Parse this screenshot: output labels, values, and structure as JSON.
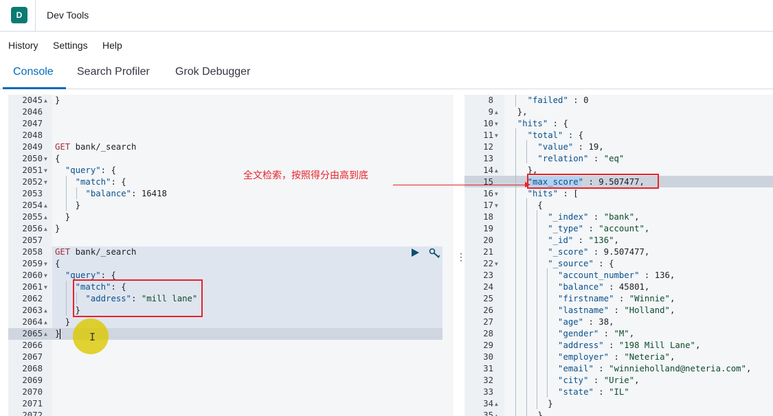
{
  "header": {
    "app_initial": "D",
    "title": "Dev Tools"
  },
  "menu": {
    "history": "History",
    "settings": "Settings",
    "help": "Help"
  },
  "tabs": {
    "console": "Console",
    "search_profiler": "Search Profiler",
    "grok_debugger": "Grok Debugger"
  },
  "annotation": {
    "text": "全文检索，按照得分由高到底"
  },
  "left_editor": {
    "lines": [
      {
        "n": "2045",
        "fold": "▲",
        "t": "}"
      },
      {
        "n": "2046",
        "fold": "",
        "t": ""
      },
      {
        "n": "2047",
        "fold": "",
        "t": ""
      },
      {
        "n": "2048",
        "fold": "",
        "t": ""
      },
      {
        "n": "2049",
        "fold": "",
        "t": "GET bank/_search"
      },
      {
        "n": "2050",
        "fold": "▼",
        "t": "{"
      },
      {
        "n": "2051",
        "fold": "▼",
        "t": "  \"query\": {"
      },
      {
        "n": "2052",
        "fold": "▼",
        "t": "    \"match\": {"
      },
      {
        "n": "2053",
        "fold": "",
        "t": "      \"balance\": 16418"
      },
      {
        "n": "2054",
        "fold": "▲",
        "t": "    }"
      },
      {
        "n": "2055",
        "fold": "▲",
        "t": "  }"
      },
      {
        "n": "2056",
        "fold": "▲",
        "t": "}"
      },
      {
        "n": "2057",
        "fold": "",
        "t": ""
      },
      {
        "n": "2058",
        "fold": "",
        "t": "GET bank/_search"
      },
      {
        "n": "2059",
        "fold": "▼",
        "t": "{"
      },
      {
        "n": "2060",
        "fold": "▼",
        "t": "  \"query\": {"
      },
      {
        "n": "2061",
        "fold": "▼",
        "t": "    \"match\": {"
      },
      {
        "n": "2062",
        "fold": "",
        "t": "      \"address\": \"mill lane\""
      },
      {
        "n": "2063",
        "fold": "▲",
        "t": "    }"
      },
      {
        "n": "2064",
        "fold": "▲",
        "t": "  }"
      },
      {
        "n": "2065",
        "fold": "▲",
        "t": "}"
      },
      {
        "n": "2066",
        "fold": "",
        "t": ""
      },
      {
        "n": "2067",
        "fold": "",
        "t": ""
      },
      {
        "n": "2068",
        "fold": "",
        "t": ""
      },
      {
        "n": "2069",
        "fold": "",
        "t": ""
      },
      {
        "n": "2070",
        "fold": "",
        "t": ""
      },
      {
        "n": "2071",
        "fold": "",
        "t": ""
      },
      {
        "n": "2072",
        "fold": "",
        "t": ""
      }
    ]
  },
  "right_editor": {
    "lines": [
      {
        "n": "8",
        "fold": "",
        "t": "    \"failed\" : 0"
      },
      {
        "n": "9",
        "fold": "▲",
        "t": "  },"
      },
      {
        "n": "10",
        "fold": "▼",
        "t": "  \"hits\" : {"
      },
      {
        "n": "11",
        "fold": "▼",
        "t": "    \"total\" : {"
      },
      {
        "n": "12",
        "fold": "",
        "t": "      \"value\" : 19,"
      },
      {
        "n": "13",
        "fold": "",
        "t": "      \"relation\" : \"eq\""
      },
      {
        "n": "14",
        "fold": "▲",
        "t": "    },"
      },
      {
        "n": "15",
        "fold": "",
        "t": "    \"max_score\" : 9.507477,"
      },
      {
        "n": "16",
        "fold": "▼",
        "t": "    \"hits\" : ["
      },
      {
        "n": "17",
        "fold": "▼",
        "t": "      {"
      },
      {
        "n": "18",
        "fold": "",
        "t": "        \"_index\" : \"bank\","
      },
      {
        "n": "19",
        "fold": "",
        "t": "        \"_type\" : \"account\","
      },
      {
        "n": "20",
        "fold": "",
        "t": "        \"_id\" : \"136\","
      },
      {
        "n": "21",
        "fold": "",
        "t": "        \"_score\" : 9.507477,"
      },
      {
        "n": "22",
        "fold": "▼",
        "t": "        \"_source\" : {"
      },
      {
        "n": "23",
        "fold": "",
        "t": "          \"account_number\" : 136,"
      },
      {
        "n": "24",
        "fold": "",
        "t": "          \"balance\" : 45801,"
      },
      {
        "n": "25",
        "fold": "",
        "t": "          \"firstname\" : \"Winnie\","
      },
      {
        "n": "26",
        "fold": "",
        "t": "          \"lastname\" : \"Holland\","
      },
      {
        "n": "27",
        "fold": "",
        "t": "          \"age\" : 38,"
      },
      {
        "n": "28",
        "fold": "",
        "t": "          \"gender\" : \"M\","
      },
      {
        "n": "29",
        "fold": "",
        "t": "          \"address\" : \"198 Mill Lane\","
      },
      {
        "n": "30",
        "fold": "",
        "t": "          \"employer\" : \"Neteria\","
      },
      {
        "n": "31",
        "fold": "",
        "t": "          \"email\" : \"winnieholland@neteria.com\","
      },
      {
        "n": "32",
        "fold": "",
        "t": "          \"city\" : \"Urie\","
      },
      {
        "n": "33",
        "fold": "",
        "t": "          \"state\" : \"IL\""
      },
      {
        "n": "34",
        "fold": "▲",
        "t": "        }"
      },
      {
        "n": "35",
        "fold": "▲",
        "t": "      },"
      }
    ]
  },
  "icons": {
    "run": "play-icon",
    "settings": "wrench-icon",
    "more": "more-vertical-icon"
  },
  "colors": {
    "accent": "#006bb8",
    "brand": "#0b7a73",
    "annotation": "#e8222a"
  }
}
